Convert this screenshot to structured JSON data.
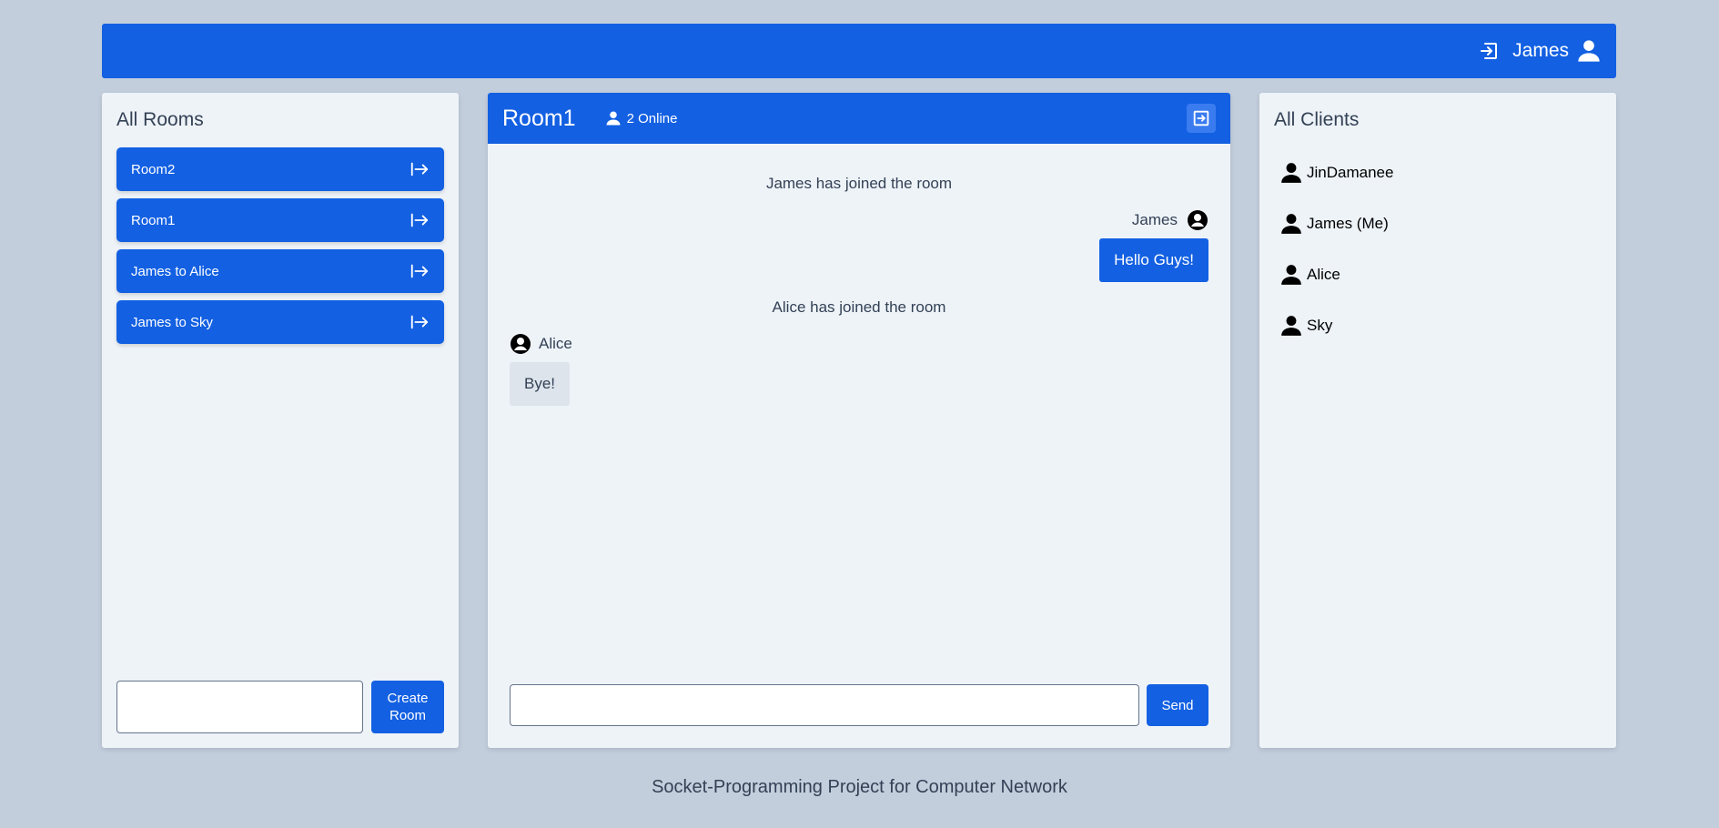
{
  "topbar": {
    "username": "James",
    "logout_icon": "logout-icon",
    "user_icon": "user-icon"
  },
  "rooms_panel": {
    "title": "All Rooms",
    "rooms": [
      {
        "label": "Room2"
      },
      {
        "label": "Room1"
      },
      {
        "label": "James to Alice"
      },
      {
        "label": "James to Sky"
      }
    ],
    "create_input_value": "",
    "create_button_line1": "Create",
    "create_button_line2": "Room"
  },
  "chat": {
    "room_name": "Room1",
    "online_text": "2 Online",
    "messages": [
      {
        "type": "system",
        "text": "James has joined the room"
      },
      {
        "type": "self",
        "sender": "James",
        "text": "Hello Guys!"
      },
      {
        "type": "system",
        "text": "Alice has joined the room"
      },
      {
        "type": "other",
        "sender": "Alice",
        "text": "Bye!"
      }
    ],
    "message_input_value": "",
    "send_label": "Send"
  },
  "clients_panel": {
    "title": "All Clients",
    "clients": [
      {
        "name": "JinDamanee"
      },
      {
        "name": "James (Me)"
      },
      {
        "name": "Alice"
      },
      {
        "name": "Sky"
      }
    ]
  },
  "footer": {
    "text": "Socket-Programming Project for Computer Network"
  },
  "colors": {
    "background": "#c3cedd",
    "primary": "#1360e2",
    "panel": "#eef3f8",
    "other_bubble": "#dde4ec"
  }
}
